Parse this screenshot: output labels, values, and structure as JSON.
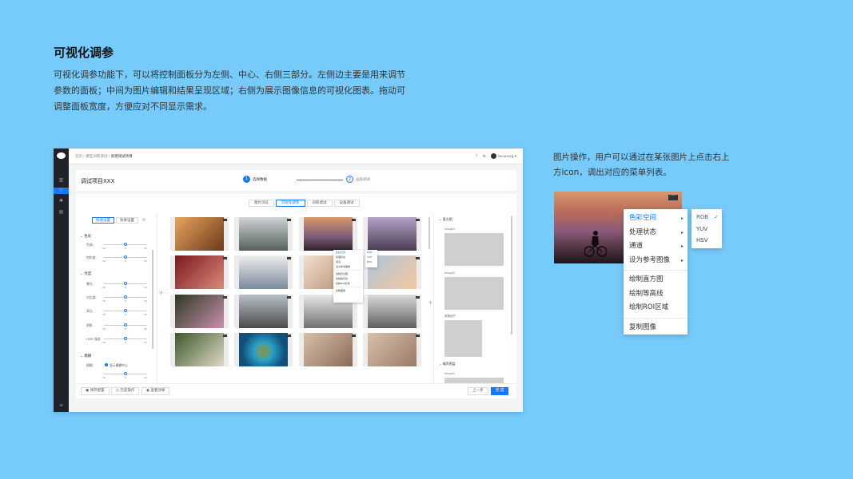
{
  "heading": {
    "title": "可视化调参",
    "description": "可视化调参功能下，可以将控制面板分为左侧、中心、右侧三部分。左侧边主要是用来调节参数的面板；中间为图片编辑和结果呈现区域；右侧为展示图像信息的可视化图表。拖动可调整面板宽度，方便应对不同显示需求。"
  },
  "right_note": "图片操作，用户可以通过在某张图片上点击右上方icon，调出对应的菜单列表。",
  "app": {
    "breadcrumb": [
      "首页",
      "模型训练调试",
      "新建调试项目"
    ],
    "user": "bo.wang",
    "project_title": "调试项目XXX",
    "steps": [
      {
        "num": "1",
        "label": "选择数据"
      },
      {
        "num": "2",
        "label": "画质调试"
      }
    ],
    "tabs": [
      "图片浏览",
      "可视化调参",
      "训练调试",
      "设备调试"
    ],
    "left_panel": {
      "buttons": [
        "快速设置",
        "效果设置"
      ],
      "refresh": "⟳",
      "sections": [
        {
          "name": "色彩",
          "params": [
            "色调:",
            "饱和度:"
          ]
        },
        {
          "name": "亮度",
          "params": [
            "曝光:",
            "对比度:",
            "高光:",
            "阴影:",
            "HDR 强度:"
          ]
        },
        {
          "name": "模糊",
          "params": [
            "模糊:"
          ]
        }
      ],
      "tick_min": "-10",
      "tick_mid": "0",
      "tick_max": "10",
      "radio_label": "显示模糊中心"
    },
    "mini_menu": [
      "色彩空间",
      "处理状态",
      "通道",
      "设为参考图像",
      "绘制直方图",
      "绘制等高线",
      "绘制ROI区域",
      "复制图像"
    ],
    "mini_submenu": [
      "RGB",
      "YUV",
      "HSV"
    ],
    "right_panel": {
      "sec1": "直方图",
      "img1": "image1",
      "img2": "image2",
      "sec2": "像素细节",
      "sec3": "噪声图层",
      "img3": "image1"
    },
    "footer": {
      "save": "保存配置",
      "history": "历史操作",
      "view": "查看效果",
      "prev": "上一步",
      "done": "完 成"
    }
  },
  "context_menu": {
    "items": [
      "色彩空间",
      "处理状态",
      "通道",
      "设为参考图像"
    ],
    "actions": [
      "绘制直方图",
      "绘制等高线",
      "绘制ROI区域"
    ],
    "copy": "复制图像",
    "submenu": [
      "RGB",
      "YUV",
      "HSV"
    ],
    "selected_colorspace": "RGB"
  },
  "icons": {
    "more": "more-dots-icon",
    "arrow": "▸",
    "check": "✓"
  },
  "colors": {
    "background": "#76cbfb",
    "accent": "#1677ff",
    "sidebar": "#1f2228"
  }
}
